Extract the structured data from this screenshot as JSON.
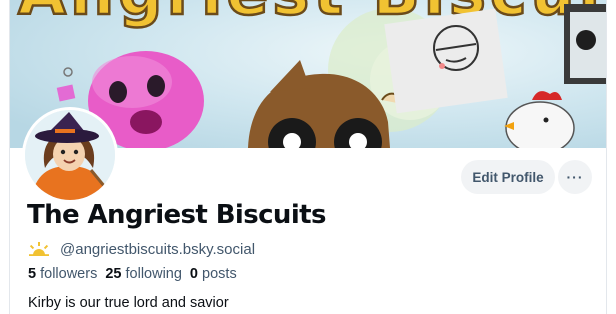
{
  "banner": {
    "title_text": "Angriest Biscuits"
  },
  "profile": {
    "display_name": "The Angriest Biscuits",
    "handle": "@angriestbiscuits.bsky.social",
    "handle_icon": "sunrise-icon",
    "followers_count": "5",
    "followers_label": "followers",
    "following_count": "25",
    "following_label": "following",
    "posts_count": "0",
    "posts_label": "posts",
    "bio": "Kirby is our true lord and savior"
  },
  "actions": {
    "edit_profile_label": "Edit Profile",
    "more_label": "···"
  },
  "colors": {
    "accent_yellow": "#f1c232",
    "banner_sky": "#c8e3ef",
    "text_primary": "#0b0f14",
    "text_secondary": "#42576c",
    "button_bg": "#f1f3f5"
  }
}
